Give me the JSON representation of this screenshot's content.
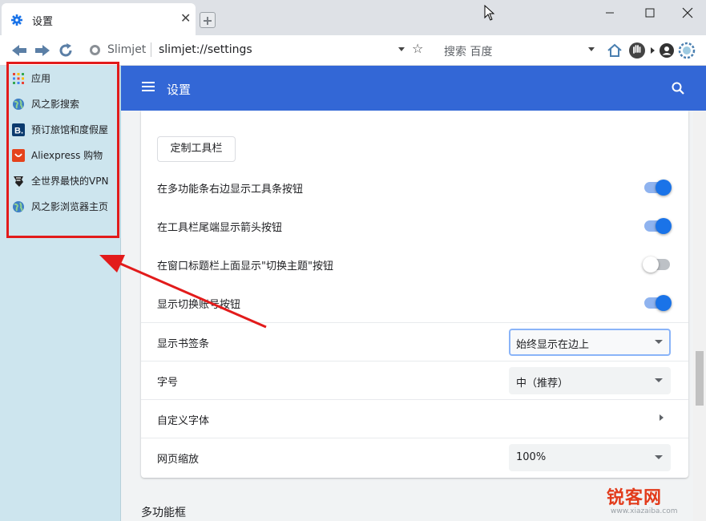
{
  "tab": {
    "title": "设置"
  },
  "toolbar": {
    "site_name": "Slimjet",
    "url": "slimjet://settings",
    "search_label": "搜索 百度"
  },
  "sidebar": {
    "items": [
      {
        "label": "应用",
        "icon": "apps-grid-icon"
      },
      {
        "label": "风之影搜索",
        "icon": "globe-icon"
      },
      {
        "label": "预订旅馆和度假屋",
        "icon": "booking-icon"
      },
      {
        "label": "Aliexpress 购物",
        "icon": "aliexpress-icon"
      },
      {
        "label": "全世界最快的VPN",
        "icon": "vpn-icon"
      },
      {
        "label": "风之影浏览器主页",
        "icon": "globe-icon"
      }
    ]
  },
  "header": {
    "title": "设置"
  },
  "settings": {
    "customize_toolbar_button": "定制工具栏",
    "rows": [
      {
        "label": "在多功能条右边显示工具条按钮",
        "toggle": "on"
      },
      {
        "label": "在工具栏尾端显示箭头按钮",
        "toggle": "on"
      },
      {
        "label": "在窗口标题栏上面显示\"切换主题\"按钮",
        "toggle": "off"
      },
      {
        "label": "显示切换账号按钮",
        "toggle": "on"
      }
    ],
    "bookmark_bar": {
      "label": "显示书签条",
      "value": "始终显示在边上"
    },
    "font_size": {
      "label": "字号",
      "value": "中（推荐）"
    },
    "custom_fonts": {
      "label": "自定义字体"
    },
    "page_zoom": {
      "label": "网页缩放",
      "value": "100%"
    },
    "next_section": "多功能框"
  },
  "colors": {
    "header": "#3367d6",
    "sidebar": "#cde5ee",
    "toggle_on": "#1a73e8",
    "annotation": "#e21b1b"
  },
  "watermark": {
    "text": "锐客网",
    "sub": "www.xiazaiba.com"
  }
}
